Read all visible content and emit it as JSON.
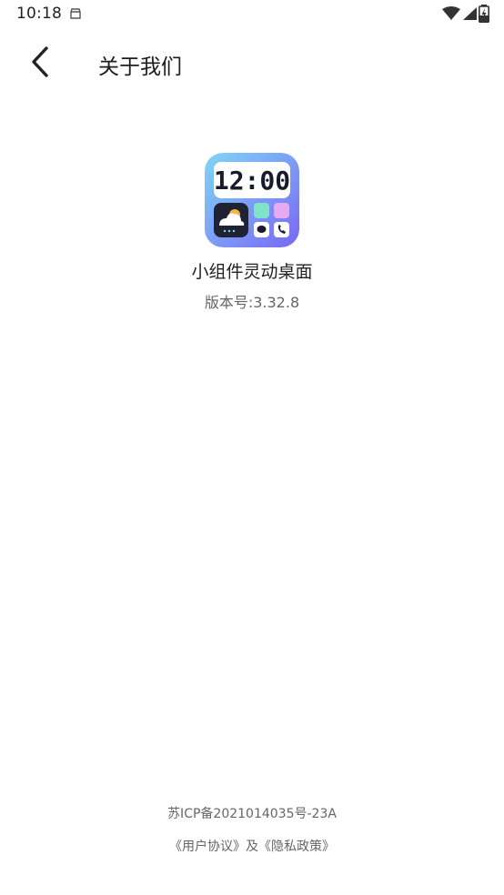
{
  "status_bar": {
    "time": "10:18",
    "icons": [
      "notification-icon",
      "wifi-icon",
      "signal-icon",
      "battery-charging-icon"
    ]
  },
  "toolbar": {
    "back_icon": "chevron-left-icon",
    "title": "关于我们"
  },
  "app": {
    "icon_clock": "12:00",
    "name": "小组件灵动桌面",
    "version": "版本号:3.32.8"
  },
  "footer": {
    "icp": "苏ICP备2021014035号-23A",
    "user_agreement": "《用户协议》",
    "conjunction": "及",
    "privacy_policy": "《隐私政策》"
  },
  "colors": {
    "icon_gradient_start": "#7FD3F5",
    "icon_gradient_end": "#7B6BF5",
    "text_primary": "#222222",
    "text_secondary": "#666666"
  }
}
